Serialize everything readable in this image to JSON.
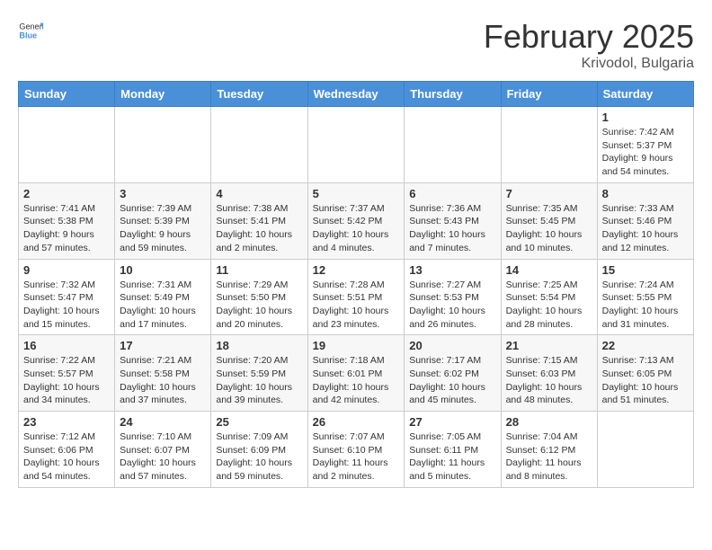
{
  "header": {
    "logo": {
      "general": "General",
      "blue": "Blue"
    },
    "title": "February 2025",
    "location": "Krivodol, Bulgaria"
  },
  "calendar": {
    "weekdays": [
      "Sunday",
      "Monday",
      "Tuesday",
      "Wednesday",
      "Thursday",
      "Friday",
      "Saturday"
    ],
    "weeks": [
      [
        {
          "day": "",
          "info": ""
        },
        {
          "day": "",
          "info": ""
        },
        {
          "day": "",
          "info": ""
        },
        {
          "day": "",
          "info": ""
        },
        {
          "day": "",
          "info": ""
        },
        {
          "day": "",
          "info": ""
        },
        {
          "day": "1",
          "info": "Sunrise: 7:42 AM\nSunset: 5:37 PM\nDaylight: 9 hours and 54 minutes."
        }
      ],
      [
        {
          "day": "2",
          "info": "Sunrise: 7:41 AM\nSunset: 5:38 PM\nDaylight: 9 hours and 57 minutes."
        },
        {
          "day": "3",
          "info": "Sunrise: 7:39 AM\nSunset: 5:39 PM\nDaylight: 9 hours and 59 minutes."
        },
        {
          "day": "4",
          "info": "Sunrise: 7:38 AM\nSunset: 5:41 PM\nDaylight: 10 hours and 2 minutes."
        },
        {
          "day": "5",
          "info": "Sunrise: 7:37 AM\nSunset: 5:42 PM\nDaylight: 10 hours and 4 minutes."
        },
        {
          "day": "6",
          "info": "Sunrise: 7:36 AM\nSunset: 5:43 PM\nDaylight: 10 hours and 7 minutes."
        },
        {
          "day": "7",
          "info": "Sunrise: 7:35 AM\nSunset: 5:45 PM\nDaylight: 10 hours and 10 minutes."
        },
        {
          "day": "8",
          "info": "Sunrise: 7:33 AM\nSunset: 5:46 PM\nDaylight: 10 hours and 12 minutes."
        }
      ],
      [
        {
          "day": "9",
          "info": "Sunrise: 7:32 AM\nSunset: 5:47 PM\nDaylight: 10 hours and 15 minutes."
        },
        {
          "day": "10",
          "info": "Sunrise: 7:31 AM\nSunset: 5:49 PM\nDaylight: 10 hours and 17 minutes."
        },
        {
          "day": "11",
          "info": "Sunrise: 7:29 AM\nSunset: 5:50 PM\nDaylight: 10 hours and 20 minutes."
        },
        {
          "day": "12",
          "info": "Sunrise: 7:28 AM\nSunset: 5:51 PM\nDaylight: 10 hours and 23 minutes."
        },
        {
          "day": "13",
          "info": "Sunrise: 7:27 AM\nSunset: 5:53 PM\nDaylight: 10 hours and 26 minutes."
        },
        {
          "day": "14",
          "info": "Sunrise: 7:25 AM\nSunset: 5:54 PM\nDaylight: 10 hours and 28 minutes."
        },
        {
          "day": "15",
          "info": "Sunrise: 7:24 AM\nSunset: 5:55 PM\nDaylight: 10 hours and 31 minutes."
        }
      ],
      [
        {
          "day": "16",
          "info": "Sunrise: 7:22 AM\nSunset: 5:57 PM\nDaylight: 10 hours and 34 minutes."
        },
        {
          "day": "17",
          "info": "Sunrise: 7:21 AM\nSunset: 5:58 PM\nDaylight: 10 hours and 37 minutes."
        },
        {
          "day": "18",
          "info": "Sunrise: 7:20 AM\nSunset: 5:59 PM\nDaylight: 10 hours and 39 minutes."
        },
        {
          "day": "19",
          "info": "Sunrise: 7:18 AM\nSunset: 6:01 PM\nDaylight: 10 hours and 42 minutes."
        },
        {
          "day": "20",
          "info": "Sunrise: 7:17 AM\nSunset: 6:02 PM\nDaylight: 10 hours and 45 minutes."
        },
        {
          "day": "21",
          "info": "Sunrise: 7:15 AM\nSunset: 6:03 PM\nDaylight: 10 hours and 48 minutes."
        },
        {
          "day": "22",
          "info": "Sunrise: 7:13 AM\nSunset: 6:05 PM\nDaylight: 10 hours and 51 minutes."
        }
      ],
      [
        {
          "day": "23",
          "info": "Sunrise: 7:12 AM\nSunset: 6:06 PM\nDaylight: 10 hours and 54 minutes."
        },
        {
          "day": "24",
          "info": "Sunrise: 7:10 AM\nSunset: 6:07 PM\nDaylight: 10 hours and 57 minutes."
        },
        {
          "day": "25",
          "info": "Sunrise: 7:09 AM\nSunset: 6:09 PM\nDaylight: 10 hours and 59 minutes."
        },
        {
          "day": "26",
          "info": "Sunrise: 7:07 AM\nSunset: 6:10 PM\nDaylight: 11 hours and 2 minutes."
        },
        {
          "day": "27",
          "info": "Sunrise: 7:05 AM\nSunset: 6:11 PM\nDaylight: 11 hours and 5 minutes."
        },
        {
          "day": "28",
          "info": "Sunrise: 7:04 AM\nSunset: 6:12 PM\nDaylight: 11 hours and 8 minutes."
        },
        {
          "day": "",
          "info": ""
        }
      ]
    ]
  }
}
